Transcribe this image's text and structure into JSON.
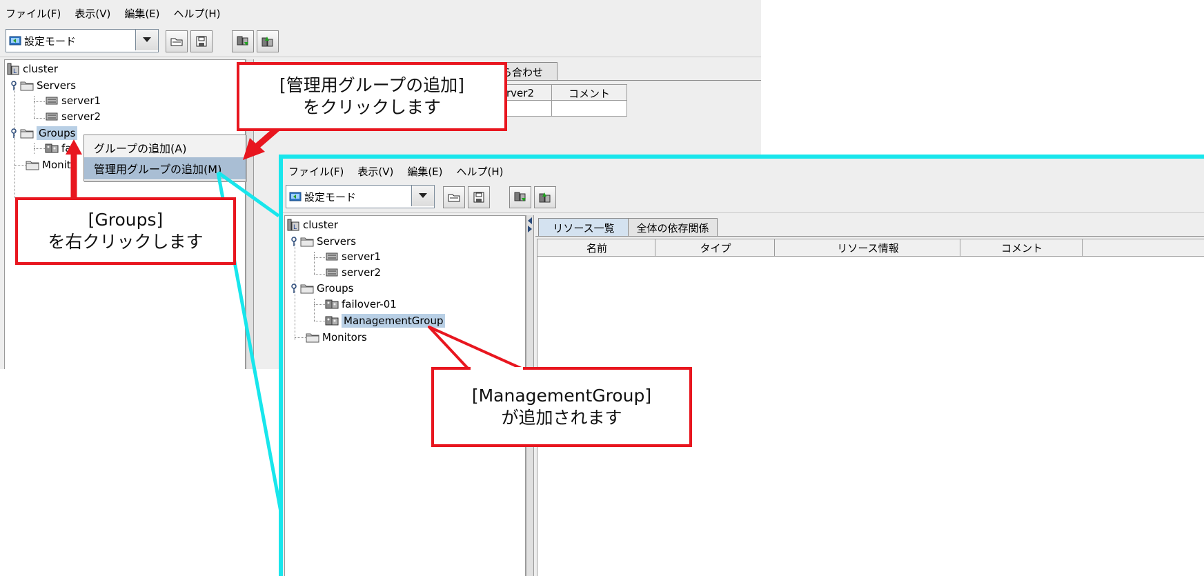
{
  "colors": {
    "callout_border": "#e8161f",
    "highlight_frame": "#18e6ec",
    "selection": "#b8cfe5",
    "menu_highlight": "#a9bed4"
  },
  "menu": [
    "ファイル(F)",
    "表示(V)",
    "編集(E)",
    "ヘルプ(H)"
  ],
  "mode_combo": {
    "value": "設定モード",
    "icon": "mode-icon"
  },
  "toolbar_icons": [
    "open-icon",
    "save-icon",
    "download-icon",
    "upload-icon"
  ],
  "back_window": {
    "tree": {
      "root": "cluster",
      "servers": "Servers",
      "server1": "server1",
      "server2": "server2",
      "groups": "Groups",
      "failover_partial": "fai",
      "monitors_partial": "Monit"
    },
    "tab_partial": "ら合わせ",
    "columns_partial": [
      "rver2",
      "コメント"
    ]
  },
  "context_menu": {
    "items": [
      "グループの追加(A)",
      "管理用グループの追加(M)"
    ]
  },
  "front_window": {
    "tree": {
      "root": "cluster",
      "servers": "Servers",
      "server1": "server1",
      "server2": "server2",
      "groups": "Groups",
      "failover": "failover-01",
      "management": "ManagementGroup",
      "monitors": "Monitors"
    },
    "tabs": [
      "リソース一覧",
      "全体の依存関係"
    ],
    "columns": [
      "名前",
      "タイプ",
      "リソース情報",
      "コメント"
    ]
  },
  "callouts": {
    "add_mgmt": [
      "[管理用グループの追加]",
      "をクリックします"
    ],
    "right_click": [
      "[Groups]",
      "を右クリックします"
    ],
    "added": [
      "[ManagementGroup]",
      "が追加されます"
    ]
  }
}
